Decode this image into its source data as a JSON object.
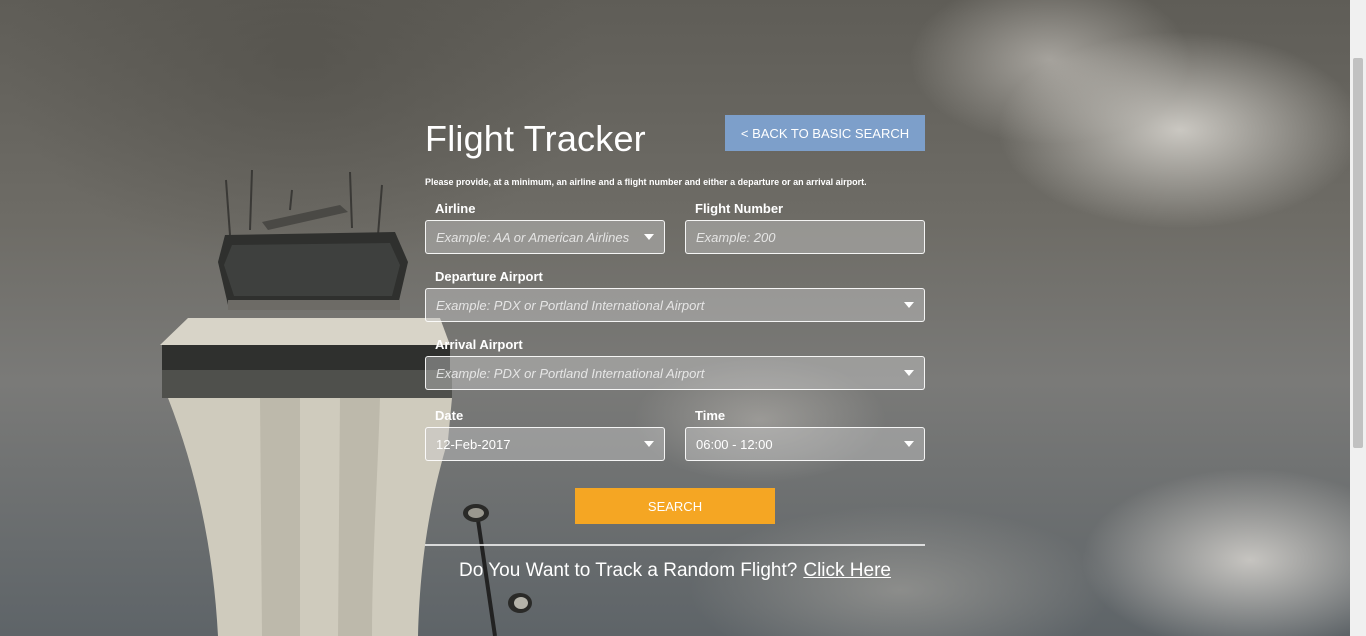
{
  "header": {
    "title": "Flight Tracker",
    "back_button": "< BACK TO BASIC SEARCH"
  },
  "hint": "Please provide, at a minimum, an airline and a flight number and either a departure or an arrival airport.",
  "form": {
    "airline": {
      "label": "Airline",
      "placeholder": "Example: AA or American Airlines"
    },
    "flight_number": {
      "label": "Flight Number",
      "placeholder": "Example: 200"
    },
    "departure": {
      "label": "Departure Airport",
      "placeholder": "Example: PDX or Portland International Airport"
    },
    "arrival": {
      "label": "Arrival Airport",
      "placeholder": "Example: PDX or Portland International Airport"
    },
    "date": {
      "label": "Date",
      "value": "12-Feb-2017"
    },
    "time": {
      "label": "Time",
      "value": "06:00 - 12:00"
    },
    "search_button": "SEARCH"
  },
  "footer": {
    "random_text": "Do You Want to Track a Random Flight?",
    "random_link": "Click Here"
  },
  "colors": {
    "back_button": "#7d9fca",
    "search_button": "#f5a623"
  },
  "icons": {
    "dropdown": "caret-down-icon"
  }
}
